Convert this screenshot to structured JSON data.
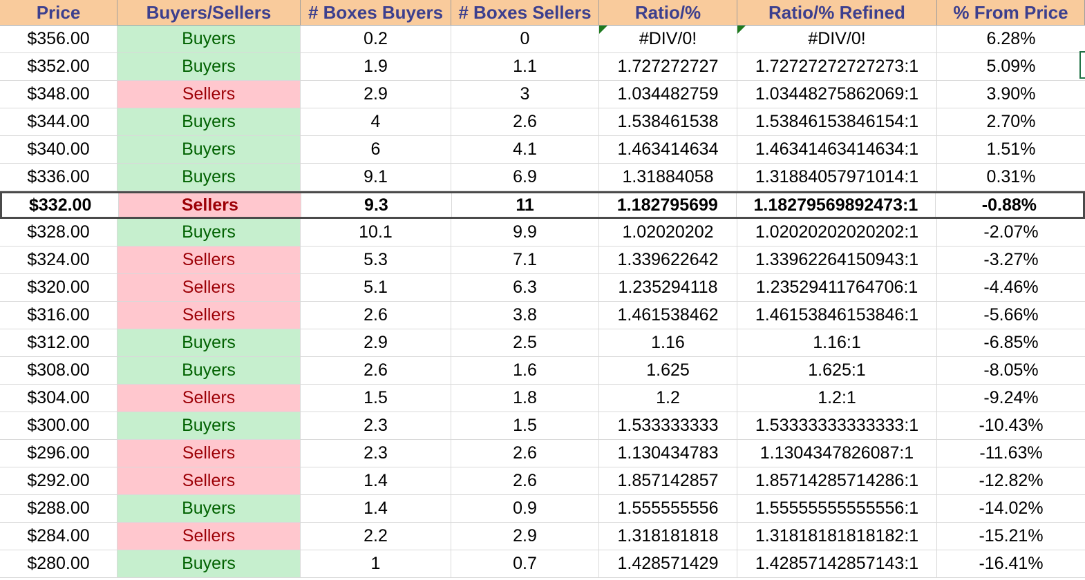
{
  "headers": [
    "Price",
    "Buyers/Sellers",
    "# Boxes Buyers",
    "# Boxes Sellers",
    "Ratio/%",
    "Ratio/% Refined",
    "% From Price"
  ],
  "colors": {
    "header_bg": "#f9cb9c",
    "header_text": "#3c3f8e",
    "buyers_bg": "#c6efce",
    "buyers_text": "#006100",
    "sellers_bg": "#ffc7ce",
    "sellers_text": "#9c0006"
  },
  "rows": [
    {
      "price": "$356.00",
      "side": "Buyers",
      "boxes_buyers": "0.2",
      "boxes_sellers": "0",
      "ratio": "#DIV/0!",
      "ratio_refined": "#DIV/0!",
      "from_price": "6.28%"
    },
    {
      "price": "$352.00",
      "side": "Buyers",
      "boxes_buyers": "1.9",
      "boxes_sellers": "1.1",
      "ratio": "1.727272727",
      "ratio_refined": "1.72727272727273:1",
      "from_price": "5.09%"
    },
    {
      "price": "$348.00",
      "side": "Sellers",
      "boxes_buyers": "2.9",
      "boxes_sellers": "3",
      "ratio": "1.034482759",
      "ratio_refined": "1.03448275862069:1",
      "from_price": "3.90%"
    },
    {
      "price": "$344.00",
      "side": "Buyers",
      "boxes_buyers": "4",
      "boxes_sellers": "2.6",
      "ratio": "1.538461538",
      "ratio_refined": "1.53846153846154:1",
      "from_price": "2.70%"
    },
    {
      "price": "$340.00",
      "side": "Buyers",
      "boxes_buyers": "6",
      "boxes_sellers": "4.1",
      "ratio": "1.463414634",
      "ratio_refined": "1.46341463414634:1",
      "from_price": "1.51%"
    },
    {
      "price": "$336.00",
      "side": "Buyers",
      "boxes_buyers": "9.1",
      "boxes_sellers": "6.9",
      "ratio": "1.31884058",
      "ratio_refined": "1.31884057971014:1",
      "from_price": "0.31%"
    },
    {
      "price": "$332.00",
      "side": "Sellers",
      "boxes_buyers": "9.3",
      "boxes_sellers": "11",
      "ratio": "1.182795699",
      "ratio_refined": "1.18279569892473:1",
      "from_price": "-0.88%",
      "current": true
    },
    {
      "price": "$328.00",
      "side": "Buyers",
      "boxes_buyers": "10.1",
      "boxes_sellers": "9.9",
      "ratio": "1.02020202",
      "ratio_refined": "1.02020202020202:1",
      "from_price": "-2.07%"
    },
    {
      "price": "$324.00",
      "side": "Sellers",
      "boxes_buyers": "5.3",
      "boxes_sellers": "7.1",
      "ratio": "1.339622642",
      "ratio_refined": "1.33962264150943:1",
      "from_price": "-3.27%"
    },
    {
      "price": "$320.00",
      "side": "Sellers",
      "boxes_buyers": "5.1",
      "boxes_sellers": "6.3",
      "ratio": "1.235294118",
      "ratio_refined": "1.23529411764706:1",
      "from_price": "-4.46%"
    },
    {
      "price": "$316.00",
      "side": "Sellers",
      "boxes_buyers": "2.6",
      "boxes_sellers": "3.8",
      "ratio": "1.461538462",
      "ratio_refined": "1.46153846153846:1",
      "from_price": "-5.66%"
    },
    {
      "price": "$312.00",
      "side": "Buyers",
      "boxes_buyers": "2.9",
      "boxes_sellers": "2.5",
      "ratio": "1.16",
      "ratio_refined": "1.16:1",
      "from_price": "-6.85%"
    },
    {
      "price": "$308.00",
      "side": "Buyers",
      "boxes_buyers": "2.6",
      "boxes_sellers": "1.6",
      "ratio": "1.625",
      "ratio_refined": "1.625:1",
      "from_price": "-8.05%"
    },
    {
      "price": "$304.00",
      "side": "Sellers",
      "boxes_buyers": "1.5",
      "boxes_sellers": "1.8",
      "ratio": "1.2",
      "ratio_refined": "1.2:1",
      "from_price": "-9.24%"
    },
    {
      "price": "$300.00",
      "side": "Buyers",
      "boxes_buyers": "2.3",
      "boxes_sellers": "1.5",
      "ratio": "1.533333333",
      "ratio_refined": "1.53333333333333:1",
      "from_price": "-10.43%"
    },
    {
      "price": "$296.00",
      "side": "Sellers",
      "boxes_buyers": "2.3",
      "boxes_sellers": "2.6",
      "ratio": "1.130434783",
      "ratio_refined": "1.1304347826087:1",
      "from_price": "-11.63%"
    },
    {
      "price": "$292.00",
      "side": "Sellers",
      "boxes_buyers": "1.4",
      "boxes_sellers": "2.6",
      "ratio": "1.857142857",
      "ratio_refined": "1.85714285714286:1",
      "from_price": "-12.82%"
    },
    {
      "price": "$288.00",
      "side": "Buyers",
      "boxes_buyers": "1.4",
      "boxes_sellers": "0.9",
      "ratio": "1.555555556",
      "ratio_refined": "1.55555555555556:1",
      "from_price": "-14.02%"
    },
    {
      "price": "$284.00",
      "side": "Sellers",
      "boxes_buyers": "2.2",
      "boxes_sellers": "2.9",
      "ratio": "1.318181818",
      "ratio_refined": "1.31818181818182:1",
      "from_price": "-15.21%"
    },
    {
      "price": "$280.00",
      "side": "Buyers",
      "boxes_buyers": "1",
      "boxes_sellers": "0.7",
      "ratio": "1.428571429",
      "ratio_refined": "1.42857142857143:1",
      "from_price": "-16.41%"
    }
  ]
}
